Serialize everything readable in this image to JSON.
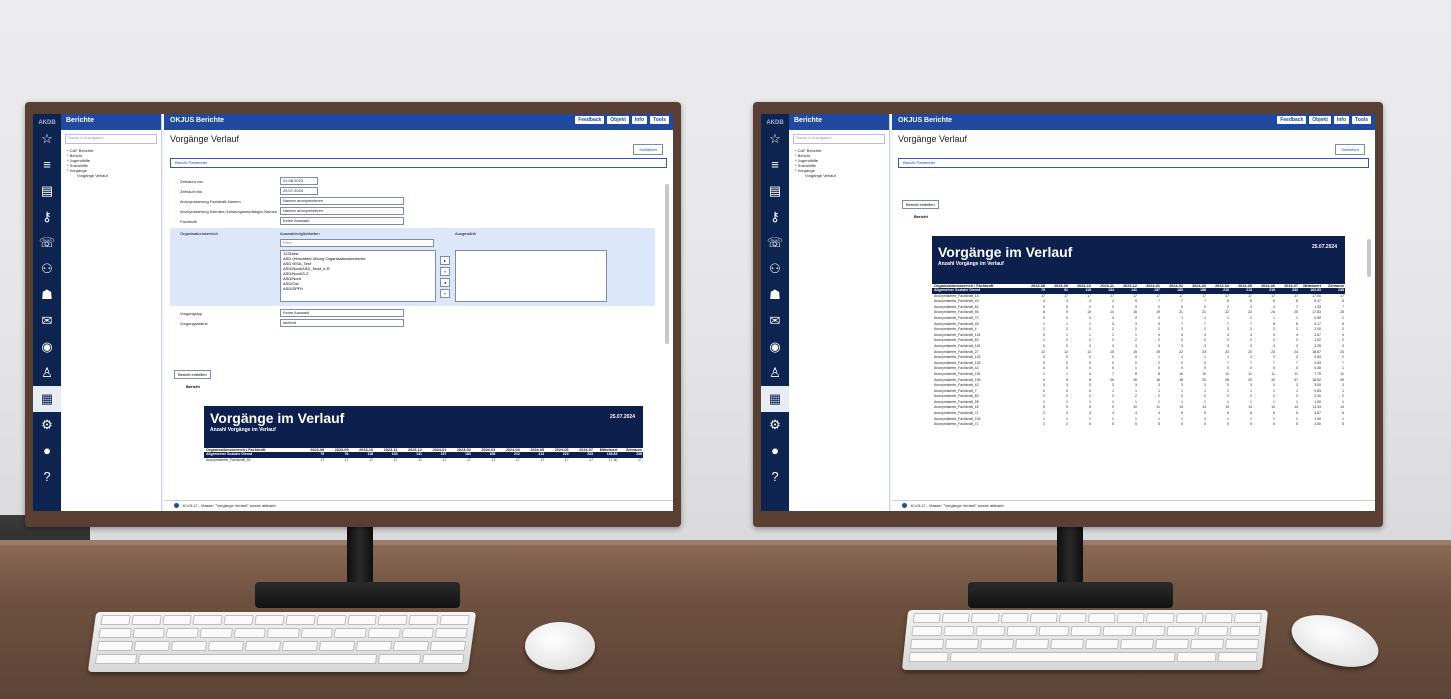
{
  "left_monitor": {
    "nav": {
      "header": "Berichte",
      "search_placeholder": "Suche in Navigation",
      "tree": [
        "* CAF Berichte",
        "* Bericht",
        "* Jugendhilfe",
        "* Sozialhilfe",
        "* Vorgänge",
        "Vorgänge Verlauf"
      ]
    },
    "app_title": "OKJUS Berichte",
    "header_buttons": [
      "Feedback",
      "Objekt",
      "Info",
      "Tools"
    ],
    "page_title": "Vorgänge Verlauf",
    "close_button": "Schließen",
    "params_bar": "Bericht Parameter",
    "form": [
      {
        "label": "Zeitraum von",
        "value": "01.08.2023"
      },
      {
        "label": "Zeitraum bis",
        "value": "25.07.2024"
      },
      {
        "label": "Anonymisierung Fachkraft-Namen",
        "value": "Namen anonymisieren"
      },
      {
        "label": "Anonymisierung Klienten-/Leistungsempfänger-Namen",
        "value": "Namen anonymisieren"
      },
      {
        "label": "Fachkraft",
        "value": "Keine Auswahl"
      }
    ],
    "org": {
      "label": "Organisationsbereich",
      "available_label": "Auswahlmöglichkeiten",
      "selected_label": "Ausgewählt",
      "filter_placeholder": "Filter",
      "options": [
        "1231test",
        "ASD (Hirschfeld Übung Organisationsbereiche",
        "ASD IESA_Test",
        "ASD/Nord/ASD_Nord_k-R",
        "ASD/Nord/S-Z",
        "ASD/Nord",
        "ASD/Ost",
        "ASD/SPFH"
      ]
    },
    "form2": [
      {
        "label": "Vorgangstyp",
        "value": "Keine Auswahl"
      },
      {
        "label": "Vorgangsstatus",
        "value": "laufend"
      }
    ],
    "create_button": "Bericht erstellen",
    "report_label": "Bericht",
    "report": {
      "title": "Vorgänge im Verlauf",
      "subtitle": "Anzahl Vorgänge im Verlauf",
      "date": "25.07.2024",
      "columns": [
        "Organisationsbereich / Fachkraft",
        "2023-08",
        "2023-09",
        "2023-10",
        "2023-11",
        "2023-12",
        "2024-01",
        "2024-02",
        "2024-03",
        "2024-04",
        "2024-05",
        "2024-06",
        "2024-07",
        "Mittelwert",
        "Zeitraum"
      ],
      "rows": [
        {
          "name": "Allgemeiner Sozialer Dienst",
          "values": [
            "79",
            "91",
            "118",
            "134",
            "141",
            "157",
            "183",
            "188",
            "210",
            "213",
            "219",
            "233",
            "163.83",
            "238"
          ]
        },
        {
          "name": "Anonymisierte_Fachkraft_92",
          "values": [
            "17",
            "17",
            "17",
            "17",
            "17",
            "17",
            "17",
            "17",
            "17",
            "17",
            "17",
            "17",
            "17.00",
            "17"
          ]
        }
      ]
    },
    "status": "10:43:17 - Maske: \"Vorgänge Verlauf\" wurde aktiviert."
  },
  "right_monitor": {
    "nav": {
      "header": "Berichte",
      "search_placeholder": "Suche in Navigation",
      "tree": [
        "* CAF Berichte",
        "* Bericht",
        "* Jugendhilfe",
        "* Sozialhilfe",
        "* Vorgänge",
        "Vorgänge Verlauf"
      ]
    },
    "app_title": "OKJUS Berichte",
    "header_buttons": [
      "Feedback",
      "Objekt",
      "Info",
      "Tools"
    ],
    "page_title": "Vorgänge Verlauf",
    "close_button": "Schließen",
    "params_bar": "Bericht Parameter",
    "create_button": "Bericht erstellen",
    "report_label": "Bericht",
    "report": {
      "title": "Vorgänge im Verlauf",
      "subtitle": "Anzahl Vorgänge im Verlauf",
      "date": "25.07.2024",
      "columns": [
        "Organisationsbereich / Fachkraft",
        "2023-08",
        "2023-09",
        "2023-10",
        "2023-11",
        "2023-12",
        "2024-01",
        "2024-02",
        "2024-03",
        "2024-04",
        "2024-05",
        "2024-06",
        "2024-07",
        "Mittelwert",
        "Zeitraum"
      ],
      "rows": [
        {
          "name": "Allgemeiner Sozialer Dienst",
          "values": [
            "79",
            "91",
            "118",
            "134",
            "141",
            "157",
            "183",
            "188",
            "210",
            "213",
            "219",
            "233",
            "163.83",
            "238"
          ]
        },
        {
          "name": "Anonymisierte_Fachkraft_13",
          "values": [
            "17",
            "17",
            "17",
            "17",
            "17",
            "17",
            "17",
            "17",
            "17",
            "17",
            "17",
            "17",
            "17.00",
            "17"
          ]
        },
        {
          "name": "Anonymisierte_Fachkraft_49",
          "values": [
            "4",
            "4",
            "4",
            "4",
            "5",
            "7",
            "7",
            "7",
            "8",
            "8",
            "8",
            "8",
            "6.17",
            "8"
          ]
        },
        {
          "name": "Anonymisierte_Fachkraft_82",
          "values": [
            "0",
            "0",
            "0",
            "0",
            "0",
            "0",
            "0",
            "0",
            "2",
            "3",
            "4",
            "7",
            "1.33",
            "7"
          ]
        },
        {
          "name": "Anonymisierte_Fachkraft_55",
          "values": [
            "8",
            "9",
            "13",
            "14",
            "15",
            "19",
            "21",
            "21",
            "22",
            "22",
            "24",
            "25",
            "17.83",
            "25"
          ]
        },
        {
          "name": "Anonymisierte_Fachkraft_70",
          "values": [
            "0",
            "0",
            "0",
            "0",
            "0",
            "0",
            "1",
            "1",
            "1",
            "1",
            "1",
            "1",
            "0.50",
            "1"
          ]
        },
        {
          "name": "Anonymisierte_Fachkraft_45",
          "values": [
            "1",
            "1",
            "1",
            "3",
            "3",
            "3",
            "7",
            "7",
            "7",
            "7",
            "8",
            "8",
            "4.17",
            "8"
          ]
        },
        {
          "name": "Anonymisierte_Fachkraft_4",
          "values": [
            "2",
            "2",
            "2",
            "2",
            "2",
            "2",
            "2",
            "2",
            "2",
            "2",
            "2",
            "2",
            "2.00",
            "2"
          ]
        },
        {
          "name": "Anonymisierte_Fachkraft_124",
          "values": [
            "0",
            "1",
            "1",
            "1",
            "1",
            "4",
            "4",
            "4",
            "4",
            "4",
            "4",
            "4",
            "2.67",
            "4"
          ]
        },
        {
          "name": "Anonymisierte_Fachkraft_63",
          "values": [
            "1",
            "2",
            "2",
            "2",
            "2",
            "2",
            "2",
            "2",
            "2",
            "2",
            "2",
            "2",
            "1.92",
            "2"
          ]
        },
        {
          "name": "Anonymisierte_Fachkraft_118",
          "values": [
            "0",
            "0",
            "0",
            "3",
            "3",
            "3",
            "3",
            "3",
            "3",
            "3",
            "3",
            "3",
            "2.25",
            "3"
          ]
        },
        {
          "name": "Anonymisierte_Fachkraft_27",
          "values": [
            "12",
            "12",
            "13",
            "15",
            "15",
            "19",
            "22",
            "23",
            "23",
            "23",
            "23",
            "24",
            "18.67",
            "24"
          ]
        },
        {
          "name": "Anonymisierte_Fachkraft_123",
          "values": [
            "0",
            "0",
            "0",
            "0",
            "0",
            "1",
            "1",
            "1",
            "1",
            "2",
            "2",
            "2",
            "0.83",
            "2"
          ]
        },
        {
          "name": "Anonymisierte_Fachkraft_125",
          "values": [
            "0",
            "0",
            "0",
            "0",
            "0",
            "2",
            "2",
            "2",
            "7",
            "7",
            "7",
            "7",
            "2.83",
            "7"
          ]
        },
        {
          "name": "Anonymisierte_Fachkraft_44",
          "values": [
            "0",
            "0",
            "0",
            "0",
            "1",
            "0",
            "0",
            "0",
            "0",
            "0",
            "0",
            "0",
            "0.08",
            "1"
          ]
        },
        {
          "name": "Anonymisierte_Fachkraft_115",
          "values": [
            "1",
            "1",
            "4",
            "7",
            "8",
            "8",
            "10",
            "10",
            "11",
            "11",
            "11",
            "11",
            "7.75",
            "11"
          ]
        },
        {
          "name": "Anonymisierte_Fachkraft_106",
          "values": [
            "0",
            "5",
            "8",
            "16",
            "16",
            "16",
            "18",
            "20",
            "28",
            "29",
            "32",
            "37",
            "18.92",
            "39"
          ]
        },
        {
          "name": "Anonymisierte_Fachkraft_42",
          "values": [
            "3",
            "3",
            "3",
            "3",
            "3",
            "3",
            "3",
            "3",
            "3",
            "3",
            "3",
            "3",
            "3.00",
            "3"
          ]
        },
        {
          "name": "Anonymisierte_Fachkraft_7",
          "values": [
            "0",
            "0",
            "0",
            "1",
            "1",
            "1",
            "1",
            "1",
            "1",
            "1",
            "1",
            "1",
            "0.83",
            "1"
          ]
        },
        {
          "name": "Anonymisierte_Fachkraft_80",
          "values": [
            "2",
            "2",
            "2",
            "2",
            "2",
            "2",
            "2",
            "2",
            "2",
            "2",
            "2",
            "2",
            "2.00",
            "2"
          ]
        },
        {
          "name": "Anonymisierte_Fachkraft_28",
          "values": [
            "1",
            "1",
            "1",
            "1",
            "1",
            "1",
            "1",
            "1",
            "1",
            "1",
            "1",
            "1",
            "1.00",
            "1"
          ]
        },
        {
          "name": "Anonymisierte_Fachkraft_18",
          "values": [
            "9",
            "9",
            "9",
            "9",
            "10",
            "11",
            "13",
            "13",
            "13",
            "13",
            "13",
            "14",
            "11.33",
            "14"
          ]
        },
        {
          "name": "Anonymisierte_Fachkraft_71",
          "values": [
            "2",
            "4",
            "4",
            "4",
            "4",
            "4",
            "5",
            "5",
            "6",
            "6",
            "6",
            "6",
            "4.67",
            "6"
          ]
        },
        {
          "name": "Anonymisierte_Fachkraft_103",
          "values": [
            "1",
            "1",
            "1",
            "1",
            "1",
            "1",
            "1",
            "1",
            "1",
            "1",
            "1",
            "1",
            "1.00",
            "1"
          ]
        },
        {
          "name": "Anonymisierte_Fachkraft_71",
          "values": [
            "2",
            "2",
            "5",
            "5",
            "5",
            "5",
            "5",
            "5",
            "5",
            "5",
            "5",
            "5",
            "4.50",
            "5"
          ]
        }
      ]
    },
    "status": "10:43:17 - Maske: \"Vorgänge Verlauf\" wurde aktiviert."
  },
  "rail_icons": [
    "star-icon",
    "menu-icon",
    "collapse-icon",
    "report-icon",
    "key-icon",
    "phone-icon",
    "people-icon",
    "family-icon",
    "mail-icon",
    "help-icon",
    "user-icon",
    "document-icon",
    "settings-icon",
    "user-icon",
    "question-icon"
  ]
}
